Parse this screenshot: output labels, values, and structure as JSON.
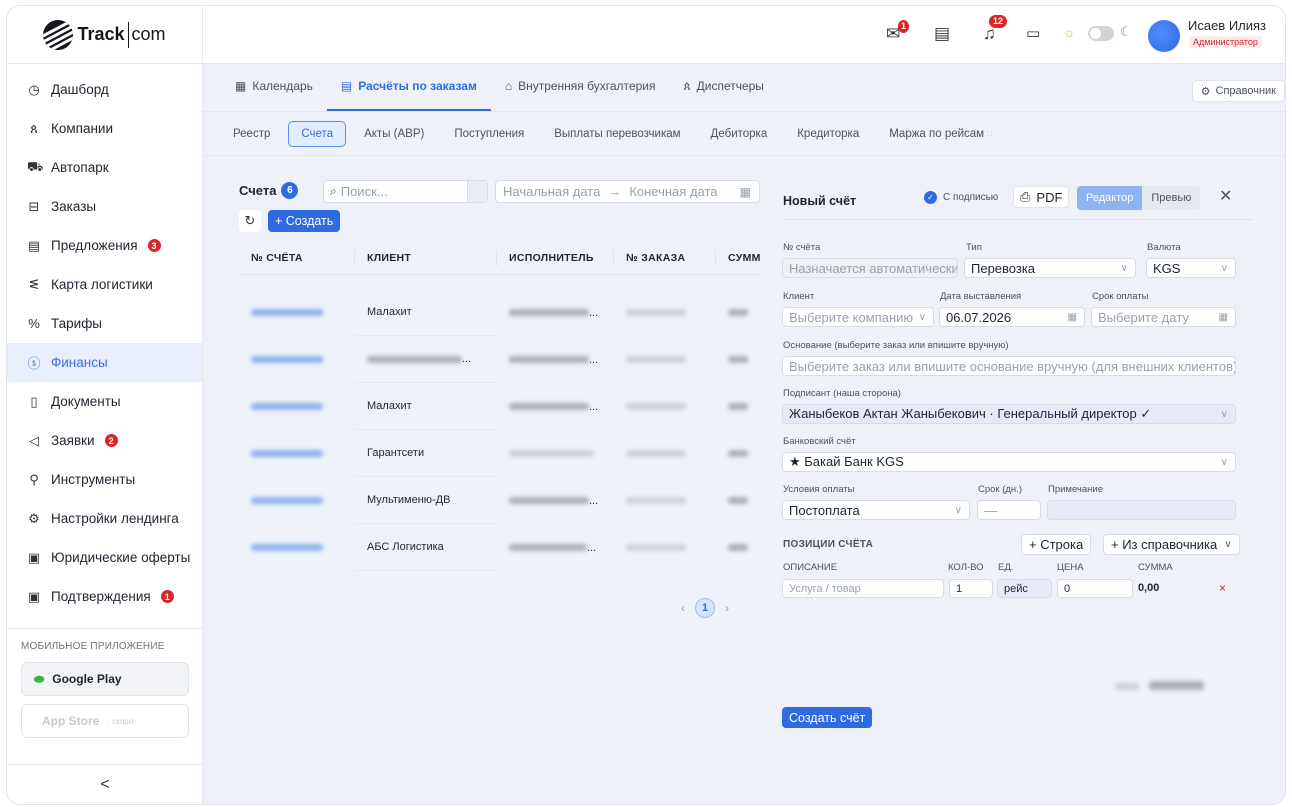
{
  "app": {
    "logo_text": "Track",
    "logo_text2": "com"
  },
  "sidebar": {
    "items": [
      {
        "label": "Дашборд",
        "icon": "gauge-icon"
      },
      {
        "label": "Компании",
        "icon": "users-icon"
      },
      {
        "label": "Автопарк",
        "icon": "car-icon"
      },
      {
        "label": "Заказы",
        "icon": "box-icon"
      },
      {
        "label": "Предложения",
        "icon": "list-icon",
        "badge": "3"
      },
      {
        "label": "Карта логистики",
        "icon": "route-icon"
      },
      {
        "label": "Тарифы",
        "icon": "percent-icon"
      },
      {
        "label": "Финансы",
        "icon": "dollar-icon",
        "active": true
      },
      {
        "label": "Документы",
        "icon": "file-icon"
      },
      {
        "label": "Заявки",
        "icon": "megaphone-icon",
        "badge": "2"
      },
      {
        "label": "Инструменты",
        "icon": "wrench-icon"
      },
      {
        "label": "Настройки лендинга",
        "icon": "gear-icon"
      },
      {
        "label": "Юридические оферты",
        "icon": "doc-icon"
      },
      {
        "label": "Подтверждения",
        "icon": "check-doc-icon",
        "badge": "1"
      }
    ],
    "mobile_title": "МОБИЛЬНОЕ ПРИЛОЖЕНИЕ",
    "google_play": "Google Play",
    "app_store": "App Store",
    "app_store_soon": "· скоро",
    "collapse": "<"
  },
  "topbar": {
    "mail_badge": "1",
    "bell_badge": "12",
    "user_name": "Исаев Илияз",
    "user_role": "Администратор"
  },
  "tabs": [
    {
      "label": "Календарь",
      "icon": "calendar-icon"
    },
    {
      "label": "Расчёты по заказам",
      "icon": "doc-icon",
      "active": true
    },
    {
      "label": "Внутренняя бухгалтерия",
      "icon": "bank-icon"
    },
    {
      "label": "Диспетчеры",
      "icon": "users-icon"
    }
  ],
  "reference_button": "Справочник",
  "subtabs": [
    {
      "label": "Реестр"
    },
    {
      "label": "Счета",
      "active": true
    },
    {
      "label": "Акты (АВР)"
    },
    {
      "label": "Поступления"
    },
    {
      "label": "Выплаты перевозчикам"
    },
    {
      "label": "Дебиторка"
    },
    {
      "label": "Кредиторка"
    },
    {
      "label": "Маржа по рейсам"
    }
  ],
  "list": {
    "title": "Счета",
    "count": "6",
    "search_placeholder": "Поиск...",
    "date_start": "Начальная дата",
    "date_arrow": "→",
    "date_end": "Конечная дата",
    "create_label": "+ Создать",
    "columns": [
      "№ СЧЁТА",
      "КЛИЕНТ",
      "ИСПОЛНИТЕЛЬ",
      "№ ЗАКАЗА",
      "СУММ"
    ],
    "rows": [
      {
        "client": "Малахит"
      },
      {
        "client": ""
      },
      {
        "client": "Малахит"
      },
      {
        "client": "Гарантсети"
      },
      {
        "client": "Мультименю-ДВ"
      },
      {
        "client": "АБС Логистика"
      }
    ],
    "page": "1"
  },
  "invoice": {
    "title": "Новый счёт",
    "with_signature": "С подписью",
    "pdf": "PDF",
    "editor": "Редактор",
    "preview": "Превью",
    "number_label": "№ счёта",
    "number_placeholder": "Назначается автоматически",
    "type_label": "Тип",
    "type_value": "Перевозка",
    "currency_label": "Валюта",
    "currency_value": "KGS",
    "client_label": "Клиент",
    "client_placeholder": "Выберите компанию",
    "issue_date_label": "Дата выставления",
    "issue_date_value": "06.07.2026",
    "due_label": "Срок оплаты",
    "due_placeholder": "Выберите дату",
    "basis_label": "Основание (выберите заказ или впишите вручную)",
    "basis_placeholder": "Выберите заказ или впишите основание вручную (для внешних клиентов)",
    "signer_label": "Подписант (наша сторона)",
    "signer_value": "Жаныбеков Актан Жаныбекович · Генеральный директор ✓",
    "bank_label": "Банковский счёт",
    "bank_value": "★ Бакай Банк KGS",
    "terms_label": "Условия оплаты",
    "terms_value": "Постоплата",
    "days_label": "Срок (дн.)",
    "days_value": "—",
    "note_label": "Примечание",
    "items_title": "ПОЗИЦИИ СЧЁТА",
    "add_row": "+ Строка",
    "from_catalog": "+ Из справочника",
    "col_desc": "ОПИСАНИЕ",
    "col_qty": "КОЛ-ВО",
    "col_unit": "ЕД.",
    "col_price": "ЦЕНА",
    "col_sum": "СУММА",
    "item_desc_placeholder": "Услуга / товар",
    "item_qty": "1",
    "item_unit": "рейс",
    "item_price": "0",
    "item_sum": "0,00",
    "remove": "×",
    "submit": "Создать счёт"
  }
}
